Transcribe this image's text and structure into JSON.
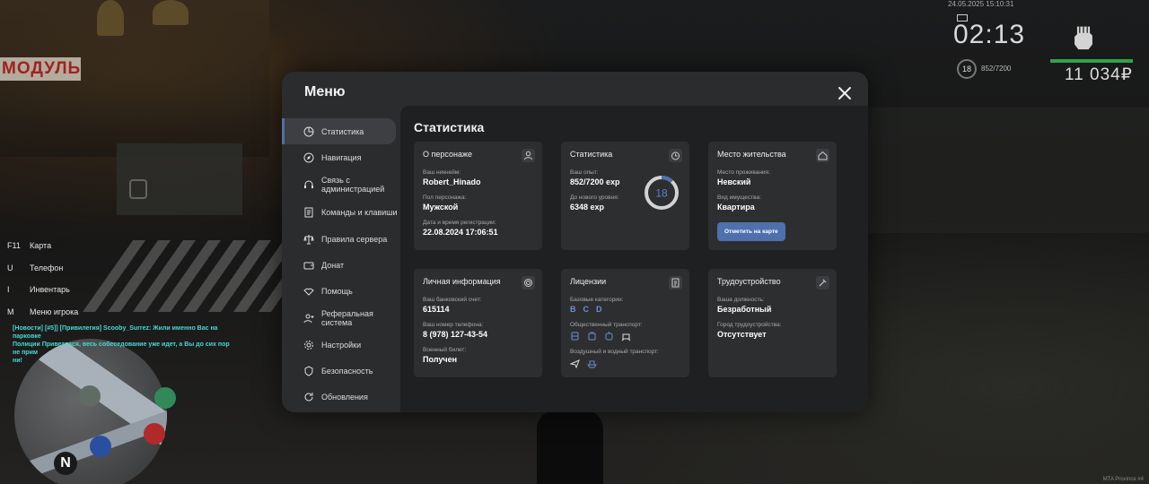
{
  "hud": {
    "datetime": "24.05.2025 15:10:31",
    "time": "02:13",
    "level": "18",
    "exp": "852/7200",
    "money": "11 034₽",
    "world_sign": "МОДУЛЬ",
    "watermark": "MTA Province #4"
  },
  "keybinds": [
    {
      "key": "F11",
      "label": "Карта"
    },
    {
      "key": "U",
      "label": "Телефон"
    },
    {
      "key": "I",
      "label": "Инвентарь"
    },
    {
      "key": "M",
      "label": "Меню игрока"
    }
  ],
  "chat": {
    "lines": [
      "[Новости] [#5]] [Привилегия] Scooby_Surrez: Жили именно Вас на парковке",
      "Полиции Приветлася, весь собеседование уже идет, а Вы до сих пор не прим",
      "ни!"
    ]
  },
  "minimap": {
    "north_label": "N"
  },
  "menu": {
    "title": "Меню",
    "sidebar": [
      {
        "label": "Статистика",
        "icon": "chart-pie-icon",
        "active": true
      },
      {
        "label": "Навигация",
        "icon": "compass-icon"
      },
      {
        "label": "Связь с администрацией",
        "icon": "headset-icon"
      },
      {
        "label": "Команды и клавиши",
        "icon": "document-icon"
      },
      {
        "label": "Правила сервера",
        "icon": "scales-icon"
      },
      {
        "label": "Донат",
        "icon": "wallet-icon"
      },
      {
        "label": "Помощь",
        "icon": "handshake-icon"
      },
      {
        "label": "Реферальная система",
        "icon": "user-plus-icon"
      },
      {
        "label": "Настройки",
        "icon": "gear-icon"
      },
      {
        "label": "Безопасность",
        "icon": "shield-icon"
      },
      {
        "label": "Обновления",
        "icon": "refresh-icon"
      }
    ]
  },
  "stats": {
    "title": "Статистика",
    "character": {
      "title": "О персонаже",
      "nickname_label": "Ваш никнейм:",
      "nickname": "Robert_Hinado",
      "gender_label": "Пол персонажа:",
      "gender": "Мужской",
      "reg_label": "Дата и время регистрации:",
      "reg": "22.08.2024 17:06:51"
    },
    "statistics": {
      "title": "Статистика",
      "exp_label": "Ваш опыт:",
      "exp": "852/7200 exp",
      "next_label": "До нового уровня:",
      "next": "6348 exp",
      "level": "18",
      "progress": 0.118
    },
    "residence": {
      "title": "Место жительства",
      "place_label": "Место проживания:",
      "place": "Невский",
      "property_label": "Вид имущества:",
      "property": "Квартира",
      "button": "Отметить на карте"
    },
    "personal": {
      "title": "Личная информация",
      "bank_label": "Ваш банковский счет:",
      "bank": "615114",
      "phone_label": "Ваш номер телефона:",
      "phone": "8 (978) 127-43-54",
      "military_label": "Военный билет:",
      "military": "Получен"
    },
    "licenses": {
      "title": "Лицензии",
      "basic_label": "Базовые категории:",
      "categories": [
        "B",
        "C",
        "D"
      ],
      "public_label": "Общественный транспорт:",
      "air_label": "Воздушный и водный транспорт:"
    },
    "employment": {
      "title": "Трудоустройство",
      "position_label": "Ваша должность:",
      "position": "Безработный",
      "city_label": "Город трудоустройства:",
      "city": "Отсутствует"
    }
  },
  "colors": {
    "accent": "#4e70ad",
    "category": "#6b8fd6",
    "money_bar": "#2fa24c"
  }
}
